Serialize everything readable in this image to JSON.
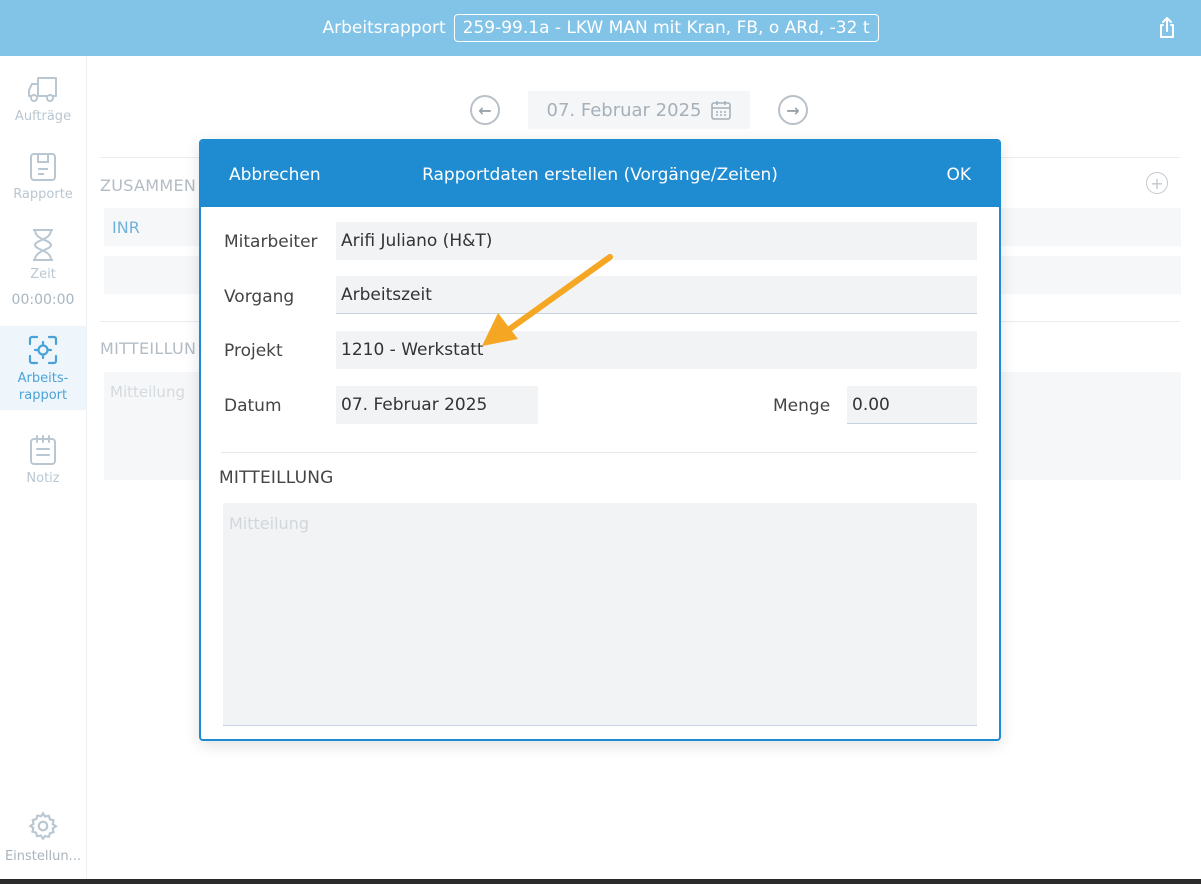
{
  "header": {
    "title": "Arbeitsrapport",
    "order": "259-99.1a - LKW MAN mit Kran, FB, o ARd, -32 t",
    "share_icon": "share-icon"
  },
  "sidebar": {
    "items": [
      {
        "label": "Aufträge",
        "icon": "truck-icon"
      },
      {
        "label": "Rapporte",
        "icon": "document-icon"
      },
      {
        "label": "Zeit",
        "icon": "hourglass-icon",
        "sub": "00:00:00"
      },
      {
        "label": "Arbeits-",
        "label2": "rapport",
        "icon": "scan-target-icon"
      },
      {
        "label": "Notiz",
        "icon": "notepad-icon"
      }
    ],
    "settings": {
      "label": "Einstellun...",
      "icon": "gear-icon"
    }
  },
  "background": {
    "date": "07. Februar 2025",
    "section1": "ZUSAMMEN",
    "link": "INR",
    "section2": "MITTEILLUN",
    "placeholder": "Mitteilung"
  },
  "modal": {
    "cancel": "Abbrechen",
    "title": "Rapportdaten erstellen (Vorgänge/Zeiten)",
    "ok": "OK",
    "fields": {
      "mitarbeiter": {
        "label": "Mitarbeiter",
        "value": "Arifi Juliano (H&T)"
      },
      "vorgang": {
        "label": "Vorgang",
        "value": "Arbeitszeit"
      },
      "projekt": {
        "label": "Projekt",
        "value": "1210 - Werkstatt"
      },
      "datum": {
        "label": "Datum",
        "value": "07. Februar 2025"
      },
      "menge": {
        "label": "Menge",
        "value": "0.00"
      }
    },
    "message": {
      "title": "MITTEILLUNG",
      "placeholder": "Mitteilung"
    }
  },
  "colors": {
    "header_bg": "#82c3e8",
    "modal_accent": "#1f8bd0",
    "annotation_arrow": "#f5a623"
  }
}
